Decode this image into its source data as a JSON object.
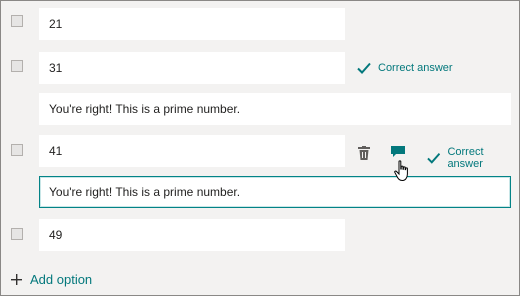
{
  "options": [
    {
      "value": "21"
    },
    {
      "value": "31",
      "correct_label": "Correct answer",
      "feedback": "You're right! This is a prime number."
    },
    {
      "value": "41",
      "correct_label": "Correct answer",
      "feedback": "You're right! This is a prime number."
    },
    {
      "value": "49"
    }
  ],
  "add_option_label": "Add option",
  "icons": {
    "checkbox": "checkbox-icon",
    "check": "checkmark-icon",
    "delete": "trash-icon",
    "feedback": "comment-icon",
    "add": "plus-icon",
    "cursor": "hand-pointer-icon"
  },
  "colors": {
    "accent": "#03787c",
    "active_border": "#038387",
    "background": "#f3f2f1",
    "field": "#ffffff"
  }
}
